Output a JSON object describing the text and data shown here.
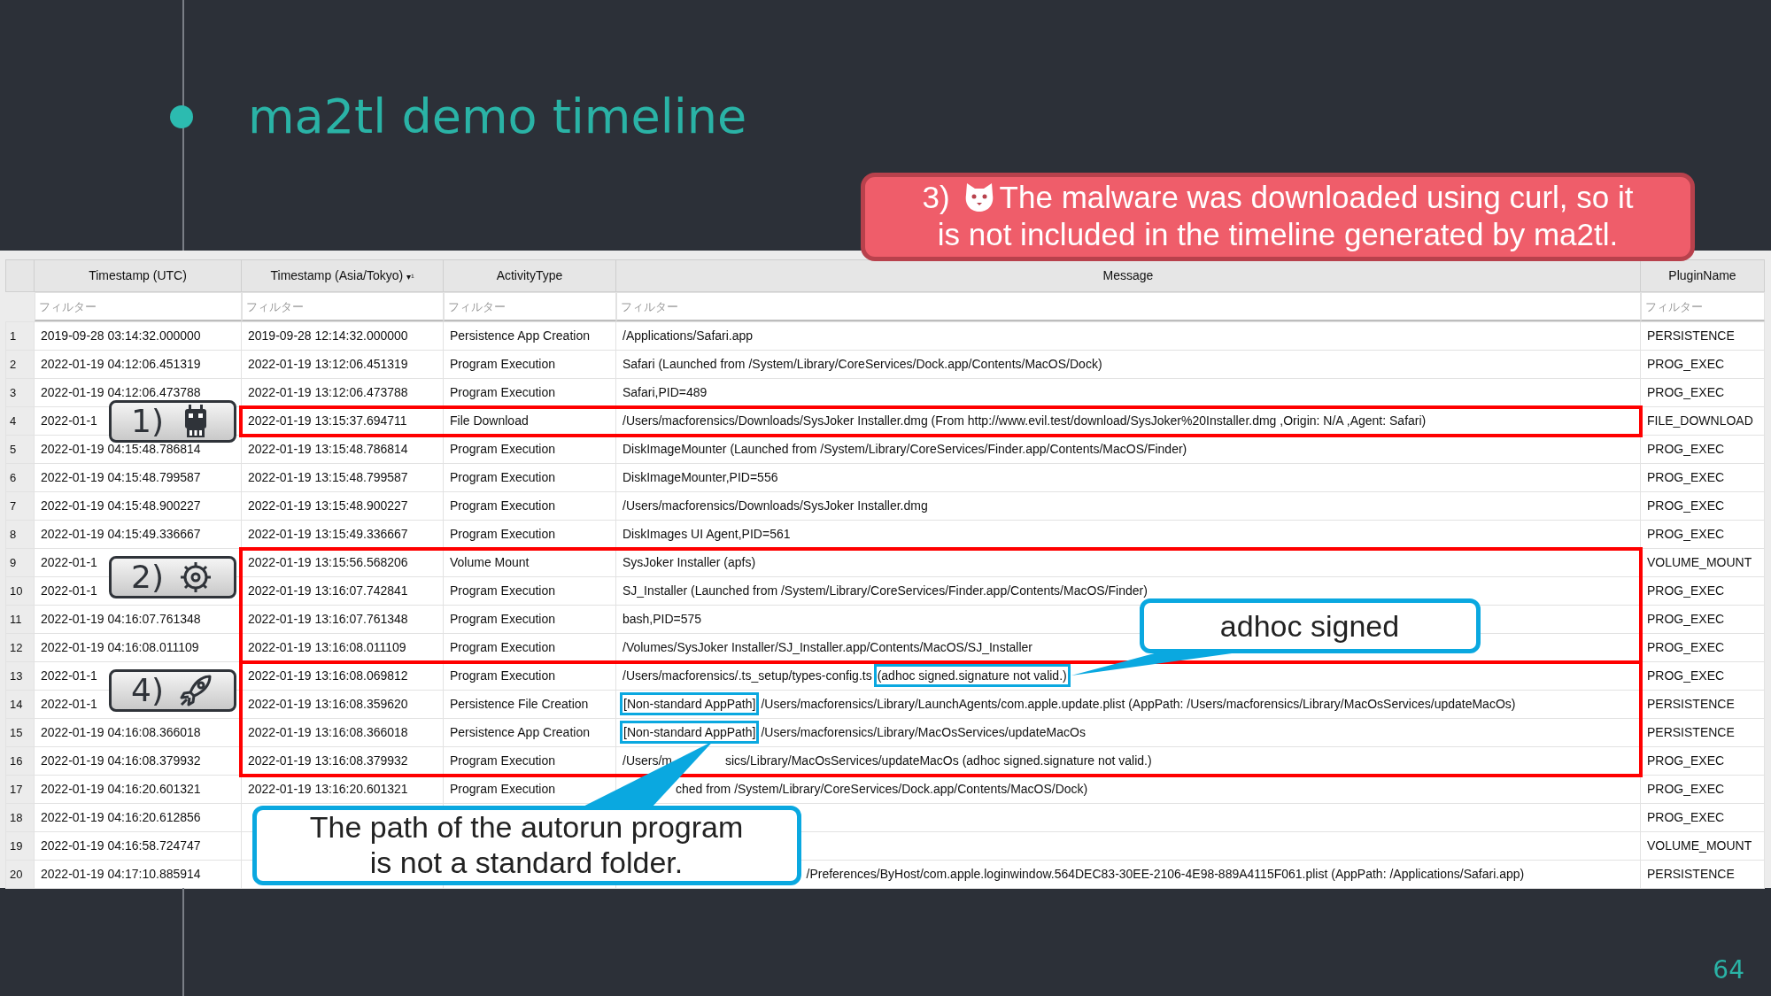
{
  "slide": {
    "title": "ma2tl demo timeline",
    "page_number": "64"
  },
  "note": {
    "number": "3)",
    "lines": [
      "The malware was downloaded using curl, so it",
      "is not included in the timeline generated by ma2tl."
    ]
  },
  "table": {
    "columns": [
      {
        "kind": "row_number"
      },
      {
        "label": "Timestamp (UTC)",
        "filter_placeholder": "フィルター"
      },
      {
        "label": "Timestamp (Asia/Tokyo)",
        "sort_mark": "▾¹",
        "filter_placeholder": "フィルター"
      },
      {
        "label": "ActivityType",
        "filter_placeholder": "フィルター"
      },
      {
        "label": "Message",
        "filter_placeholder": "フィルター"
      },
      {
        "label": "PluginName",
        "filter_placeholder": "フィルター"
      }
    ],
    "rows": [
      {
        "no": "1",
        "utc": "2019-09-28 03:14:32.000000",
        "tokyo": "2019-09-28 12:14:32.000000",
        "activity": "Persistence App Creation",
        "message": [
          {
            "text": "/Applications/Safari.app",
            "kind": "plain"
          }
        ],
        "plugin": "PERSISTENCE",
        "framed": false,
        "frame_top": false
      },
      {
        "no": "2",
        "utc": "2022-01-19 04:12:06.451319",
        "tokyo": "2022-01-19 13:12:06.451319",
        "activity": "Program Execution",
        "message": [
          {
            "text": "Safari (Launched from /System/Library/CoreServices/Dock.app/Contents/MacOS/Dock)",
            "kind": "plain"
          }
        ],
        "plugin": "PROG_EXEC",
        "framed": false,
        "frame_top": false
      },
      {
        "no": "3",
        "utc": "2022-01-19 04:12:06.473788",
        "tokyo": "2022-01-19 13:12:06.473788",
        "activity": "Program Execution",
        "message": [
          {
            "text": "Safari,PID=489",
            "kind": "plain"
          }
        ],
        "plugin": "PROG_EXEC",
        "framed": false,
        "frame_top": false
      },
      {
        "no": "4",
        "utc": "2022-01-1",
        "tokyo": "2022-01-19 13:15:37.694711",
        "activity": "File Download",
        "message": [
          {
            "text": "/Users/macforensics/Downloads/SysJoker Installer.dmg (From http://www.evil.test/download/SysJoker%20Installer.dmg ,Origin: N/A ,Agent: Safari)",
            "kind": "plain"
          }
        ],
        "plugin": "FILE_DOWNLOAD",
        "framed": true,
        "frame_top": true,
        "marker": {
          "label": "1)",
          "spans_next": false
        }
      },
      {
        "no": "5",
        "utc": "2022-01-19 04:15:48.786814",
        "tokyo": "2022-01-19 13:15:48.786814",
        "activity": "Program Execution",
        "message": [
          {
            "text": "DiskImageMounter (Launched from /System/Library/CoreServices/Finder.app/Contents/MacOS/Finder)",
            "kind": "plain"
          }
        ],
        "plugin": "PROG_EXEC",
        "framed": false,
        "frame_top": false
      },
      {
        "no": "6",
        "utc": "2022-01-19 04:15:48.799587",
        "tokyo": "2022-01-19 13:15:48.799587",
        "activity": "Program Execution",
        "message": [
          {
            "text": "DiskImageMounter,PID=556",
            "kind": "plain"
          }
        ],
        "plugin": "PROG_EXEC",
        "framed": false,
        "frame_top": false
      },
      {
        "no": "7",
        "utc": "2022-01-19 04:15:48.900227",
        "tokyo": "2022-01-19 13:15:48.900227",
        "activity": "Program Execution",
        "message": [
          {
            "text": "/Users/macforensics/Downloads/SysJoker Installer.dmg",
            "kind": "plain"
          }
        ],
        "plugin": "PROG_EXEC",
        "framed": false,
        "frame_top": false
      },
      {
        "no": "8",
        "utc": "2022-01-19 04:15:49.336667",
        "tokyo": "2022-01-19 13:15:49.336667",
        "activity": "Program Execution",
        "message": [
          {
            "text": "DiskImages UI Agent,PID=561",
            "kind": "plain"
          }
        ],
        "plugin": "PROG_EXEC",
        "framed": false,
        "frame_top": false
      },
      {
        "no": "9",
        "utc": "2022-01-1",
        "tokyo": "2022-01-19 13:15:56.568206",
        "activity": "Volume Mount",
        "message": [
          {
            "text": "SysJoker Installer (apfs)",
            "kind": "plain"
          }
        ],
        "plugin": "VOLUME_MOUNT",
        "framed": true,
        "frame_top": true,
        "marker": {
          "label": "2)",
          "spans_next": true
        }
      },
      {
        "no": "10",
        "utc": "2022-01-1",
        "tokyo": "2022-01-19 13:16:07.742841",
        "activity": "Program Execution",
        "message": [
          {
            "text": "SJ_Installer (Launched from /System/Library/CoreServices/Finder.app/Contents/MacOS/Finder)",
            "kind": "plain"
          }
        ],
        "plugin": "PROG_EXEC",
        "framed": true,
        "frame_top": false
      },
      {
        "no": "11",
        "utc": "2022-01-19 04:16:07.761348",
        "tokyo": "2022-01-19 13:16:07.761348",
        "activity": "Program Execution",
        "message": [
          {
            "text": "bash,PID=575",
            "kind": "plain"
          }
        ],
        "plugin": "PROG_EXEC",
        "framed": true,
        "frame_top": false
      },
      {
        "no": "12",
        "utc": "2022-01-19 04:16:08.011109",
        "tokyo": "2022-01-19 13:16:08.011109",
        "activity": "Program Execution",
        "message": [
          {
            "text": "/Volumes/SysJoker Installer/SJ_Installer.app/Contents/MacOS/SJ_Installer",
            "kind": "plain"
          }
        ],
        "plugin": "PROG_EXEC",
        "framed": true,
        "frame_top": false,
        "callout": {
          "lines": [
            "adhoc signed"
          ]
        }
      },
      {
        "no": "13",
        "utc": "2022-01-1",
        "tokyo": "2022-01-19 13:16:08.069812",
        "activity": "Program Execution",
        "message": [
          {
            "text": "/Users/macforensics/.ts_setup/types-config.ts",
            "kind": "plain"
          },
          {
            "text": "(adhoc signed.signature not valid.)",
            "kind": "marked"
          }
        ],
        "plugin": "PROG_EXEC",
        "framed": true,
        "frame_top": true,
        "marker": {
          "label": "4)",
          "spans_next": true
        }
      },
      {
        "no": "14",
        "utc": "2022-01-1",
        "tokyo": "2022-01-19 13:16:08.359620",
        "activity": "Persistence File Creation",
        "message": [
          {
            "text": "[Non-standard AppPath]",
            "kind": "marked"
          },
          {
            "text": "/Users/macforensics/Library/LaunchAgents/com.apple.update.plist (AppPath: /Users/macforensics/Library/MacOsServices/updateMacOs)",
            "kind": "plain"
          }
        ],
        "plugin": "PERSISTENCE",
        "framed": true,
        "frame_top": false
      },
      {
        "no": "15",
        "utc": "2022-01-19 04:16:08.366018",
        "tokyo": "2022-01-19 13:16:08.366018",
        "activity": "Persistence App Creation",
        "message": [
          {
            "text": "[Non-standard AppPath]",
            "kind": "marked"
          },
          {
            "text": "/Users/macforensics/Library/MacOsServices/updateMacOs",
            "kind": "plain"
          }
        ],
        "plugin": "PERSISTENCE",
        "framed": true,
        "frame_top": false
      },
      {
        "no": "16",
        "utc": "2022-01-19 04:16:08.379932",
        "tokyo": "2022-01-19 13:16:08.379932",
        "activity": "Program Execution",
        "message": [
          {
            "text": "/Users/m",
            "kind": "plain"
          },
          {
            "text": "sics/Library/MacOsServices/updateMacOs (adhoc signed.signature not valid.)",
            "kind": "cut"
          }
        ],
        "plugin": "PROG_EXEC",
        "framed": true,
        "frame_top": false
      },
      {
        "no": "17",
        "utc": "2022-01-19 04:16:20.601321",
        "tokyo": "2022-01-19 13:16:20.601321",
        "activity": "Program Execution",
        "message": [
          {
            "text": "ched from /System/Library/CoreServices/Dock.app/Contents/MacOS/Dock)",
            "kind": "cut"
          }
        ],
        "plugin": "PROG_EXEC",
        "framed": false,
        "frame_top": false
      },
      {
        "no": "18",
        "utc": "2022-01-19 04:16:20.612856",
        "plugin": "PROG_EXEC",
        "framed": false,
        "frame_top": false,
        "callout": {
          "lines": [
            "The path of the autorun program",
            "is not a standard folder."
          ]
        }
      },
      {
        "no": "19",
        "utc": "2022-01-19 04:16:58.724747",
        "plugin": "VOLUME_MOUNT",
        "framed": false,
        "frame_top": false
      },
      {
        "no": "20",
        "utc": "2022-01-19 04:17:10.885914",
        "message": [
          {
            "text": "/Preferences/ByHost/com.apple.loginwindow.564DEC83-30EE-2106-4E98-889A4115F061.plist (AppPath: /Applications/Safari.app)",
            "kind": "past_callout"
          }
        ],
        "plugin": "PERSISTENCE",
        "framed": false,
        "frame_top": false
      }
    ]
  }
}
